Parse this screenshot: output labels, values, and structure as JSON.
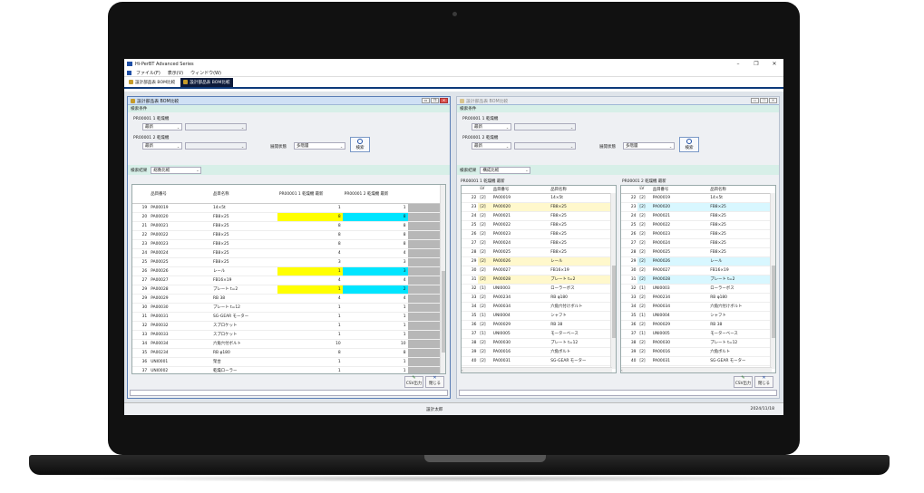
{
  "window": {
    "title": "Hi-PerBT Advanced Series",
    "min": "–",
    "max": "❐",
    "close": "✕"
  },
  "menu": [
    "ファイル(F)",
    "表示(V)",
    "ウィンドウ(W)"
  ],
  "tabs": [
    "設計部品表 BOM比較",
    "設計部品表 BOM比較"
  ],
  "status": {
    "user": "設計太郎",
    "date": "2024/11/18"
  },
  "colors": {
    "accent": "#0d3a7a",
    "diff_yellow": "#ffff00",
    "diff_cyan": "#00e5ff"
  },
  "left": {
    "title": "設計部品表 BOM比較",
    "search_section": "検索条件",
    "pr1_label": "PR00001 1 乾燥機",
    "pr1_version": "最新",
    "pr2_label": "PR00001 2 乾燥機",
    "pr2_version": "最新",
    "expand_label": "展開状態",
    "expand_value": "多階層",
    "search_button": "検索",
    "result_label": "検索結果",
    "result_mode": "総数比較",
    "headers": {
      "part_no": "品目番号",
      "part_name": "品目名称",
      "q1": "PR00001 1 乾燥機 最新",
      "q2": "PR00001 2 乾燥機 最新"
    },
    "rows": [
      {
        "no": "19",
        "code": "PA00019",
        "name": "14×5t",
        "q1": "1",
        "q2": "1",
        "hl": ""
      },
      {
        "no": "20",
        "code": "PA00020",
        "name": "FB8×25",
        "q1": "8",
        "q2": "8",
        "hl": "diff"
      },
      {
        "no": "21",
        "code": "PA00021",
        "name": "FB8×25",
        "q1": "8",
        "q2": "8",
        "hl": ""
      },
      {
        "no": "22",
        "code": "PA00022",
        "name": "FB8×25",
        "q1": "8",
        "q2": "8",
        "hl": ""
      },
      {
        "no": "23",
        "code": "PA00023",
        "name": "FB8×25",
        "q1": "8",
        "q2": "8",
        "hl": ""
      },
      {
        "no": "24",
        "code": "PA00024",
        "name": "FB8×25",
        "q1": "4",
        "q2": "4",
        "hl": ""
      },
      {
        "no": "25",
        "code": "PA00025",
        "name": "FB8×25",
        "q1": "3",
        "q2": "3",
        "hl": ""
      },
      {
        "no": "26",
        "code": "PA00026",
        "name": "レール",
        "q1": "1",
        "q2": "3",
        "hl": "diff"
      },
      {
        "no": "27",
        "code": "PA00027",
        "name": "FB16×19",
        "q1": "4",
        "q2": "4",
        "hl": ""
      },
      {
        "no": "29",
        "code": "PA00028",
        "name": "プレート t=2",
        "q1": "1",
        "q2": "2",
        "hl": "diff"
      },
      {
        "no": "29",
        "code": "PA00029",
        "name": "RB 38",
        "q1": "4",
        "q2": "4",
        "hl": ""
      },
      {
        "no": "30",
        "code": "PA00030",
        "name": "プレート t=12",
        "q1": "1",
        "q2": "1",
        "hl": ""
      },
      {
        "no": "31",
        "code": "PA00031",
        "name": "SG-GEAR モーター",
        "q1": "1",
        "q2": "1",
        "hl": ""
      },
      {
        "no": "32",
        "code": "PA00032",
        "name": "スプロケット",
        "q1": "1",
        "q2": "1",
        "hl": ""
      },
      {
        "no": "33",
        "code": "PA00033",
        "name": "スプロケット",
        "q1": "1",
        "q2": "1",
        "hl": ""
      },
      {
        "no": "34",
        "code": "PA00034",
        "name": "六角穴付ボルト",
        "q1": "10",
        "q2": "10",
        "hl": ""
      },
      {
        "no": "35",
        "code": "PA00234",
        "name": "RB φ180",
        "q1": "8",
        "q2": "8",
        "hl": ""
      },
      {
        "no": "36",
        "code": "UNI0001",
        "name": "架台",
        "q1": "1",
        "q2": "1",
        "hl": ""
      },
      {
        "no": "37",
        "code": "UNI0002",
        "name": "乾燥ローラー",
        "q1": "1",
        "q2": "1",
        "hl": ""
      }
    ],
    "csv_button": "CSV出力",
    "close_button": "閉じる"
  },
  "right": {
    "title": "設計部品表 BOM比較",
    "search_section": "検索条件",
    "pr1_label": "PR00001 1 乾燥機",
    "pr1_version": "最新",
    "pr2_label": "PR00001 2 乾燥機",
    "pr2_version": "最新",
    "expand_label": "展開状態",
    "expand_value": "多階層",
    "search_button": "検索",
    "result_label": "検索結果",
    "result_mode": "構成比較",
    "sub1_title": "PR00001 1 乾燥機 最新",
    "sub2_title": "PR00001 2 乾燥機 最新",
    "headers": {
      "lv": "LV",
      "part_no": "品目番号",
      "part_name": "品目名称"
    },
    "rows1": [
      {
        "no": "22",
        "lv": "[2]",
        "code": "PA00019",
        "name": "14×5t",
        "hl": ""
      },
      {
        "no": "23",
        "lv": "[2]",
        "code": "PA00020",
        "name": "FB8×25",
        "hl": "diff"
      },
      {
        "no": "24",
        "lv": "[2]",
        "code": "PA00021",
        "name": "FB8×25",
        "hl": ""
      },
      {
        "no": "25",
        "lv": "[2]",
        "code": "PA00022",
        "name": "FB8×25",
        "hl": ""
      },
      {
        "no": "26",
        "lv": "[2]",
        "code": "PA00023",
        "name": "FB8×25",
        "hl": ""
      },
      {
        "no": "27",
        "lv": "[2]",
        "code": "PA00024",
        "name": "FB8×25",
        "hl": ""
      },
      {
        "no": "28",
        "lv": "[2]",
        "code": "PA00025",
        "name": "FB8×25",
        "hl": ""
      },
      {
        "no": "29",
        "lv": "[2]",
        "code": "PA00026",
        "name": "レール",
        "hl": "diff"
      },
      {
        "no": "30",
        "lv": "[2]",
        "code": "PA00027",
        "name": "FB16×19",
        "hl": ""
      },
      {
        "no": "31",
        "lv": "[2]",
        "code": "PA00028",
        "name": "プレート t=2",
        "hl": "diff"
      },
      {
        "no": "32",
        "lv": "[1]",
        "code": "UNI0003",
        "name": "ローラーボス",
        "hl": ""
      },
      {
        "no": "33",
        "lv": "[2]",
        "code": "PA00234",
        "name": "RB φ180",
        "hl": ""
      },
      {
        "no": "34",
        "lv": "[2]",
        "code": "PA00034",
        "name": "六角穴付けボルト",
        "hl": ""
      },
      {
        "no": "35",
        "lv": "[1]",
        "code": "UNI0004",
        "name": "シャフト",
        "hl": ""
      },
      {
        "no": "36",
        "lv": "[2]",
        "code": "PA00029",
        "name": "RB 38",
        "hl": ""
      },
      {
        "no": "37",
        "lv": "[1]",
        "code": "UNI0005",
        "name": "モーターベース",
        "hl": ""
      },
      {
        "no": "38",
        "lv": "[2]",
        "code": "PA00030",
        "name": "プレート t=12",
        "hl": ""
      },
      {
        "no": "39",
        "lv": "[2]",
        "code": "PA00016",
        "name": "六角ボルト",
        "hl": ""
      },
      {
        "no": "40",
        "lv": "[2]",
        "code": "PA00031",
        "name": "SG-GEAR モーター",
        "hl": ""
      }
    ],
    "rows2": [
      {
        "no": "22",
        "lv": "[2]",
        "code": "PA00019",
        "name": "14×5t",
        "hl": ""
      },
      {
        "no": "23",
        "lv": "[2]",
        "code": "PA00020",
        "name": "FB8×25",
        "hl": "diff"
      },
      {
        "no": "24",
        "lv": "[2]",
        "code": "PA00021",
        "name": "FB8×25",
        "hl": ""
      },
      {
        "no": "25",
        "lv": "[2]",
        "code": "PA00022",
        "name": "FB8×25",
        "hl": ""
      },
      {
        "no": "26",
        "lv": "[2]",
        "code": "PA00023",
        "name": "FB8×25",
        "hl": ""
      },
      {
        "no": "27",
        "lv": "[2]",
        "code": "PA00024",
        "name": "FB8×25",
        "hl": ""
      },
      {
        "no": "28",
        "lv": "[2]",
        "code": "PA00025",
        "name": "FB8×25",
        "hl": ""
      },
      {
        "no": "29",
        "lv": "[2]",
        "code": "PA00026",
        "name": "レール",
        "hl": "diff"
      },
      {
        "no": "30",
        "lv": "[2]",
        "code": "PA00027",
        "name": "FB16×19",
        "hl": ""
      },
      {
        "no": "31",
        "lv": "[2]",
        "code": "PA00028",
        "name": "プレート t=2",
        "hl": "diff"
      },
      {
        "no": "32",
        "lv": "[1]",
        "code": "UNI0003",
        "name": "ローラーボス",
        "hl": ""
      },
      {
        "no": "33",
        "lv": "[2]",
        "code": "PA00234",
        "name": "RB φ180",
        "hl": ""
      },
      {
        "no": "34",
        "lv": "[2]",
        "code": "PA00034",
        "name": "六角穴付けボルト",
        "hl": ""
      },
      {
        "no": "35",
        "lv": "[1]",
        "code": "UNI0004",
        "name": "シャフト",
        "hl": ""
      },
      {
        "no": "36",
        "lv": "[2]",
        "code": "PA00029",
        "name": "RB 38",
        "hl": ""
      },
      {
        "no": "37",
        "lv": "[1]",
        "code": "UNI0005",
        "name": "モーターベース",
        "hl": ""
      },
      {
        "no": "38",
        "lv": "[2]",
        "code": "PA00030",
        "name": "プレート t=12",
        "hl": ""
      },
      {
        "no": "39",
        "lv": "[2]",
        "code": "PA00016",
        "name": "六角ボルト",
        "hl": ""
      },
      {
        "no": "40",
        "lv": "[2]",
        "code": "PA00031",
        "name": "SG-GEAR モーター",
        "hl": ""
      }
    ],
    "csv_button": "CSV出力",
    "close_button": "閉じる"
  }
}
